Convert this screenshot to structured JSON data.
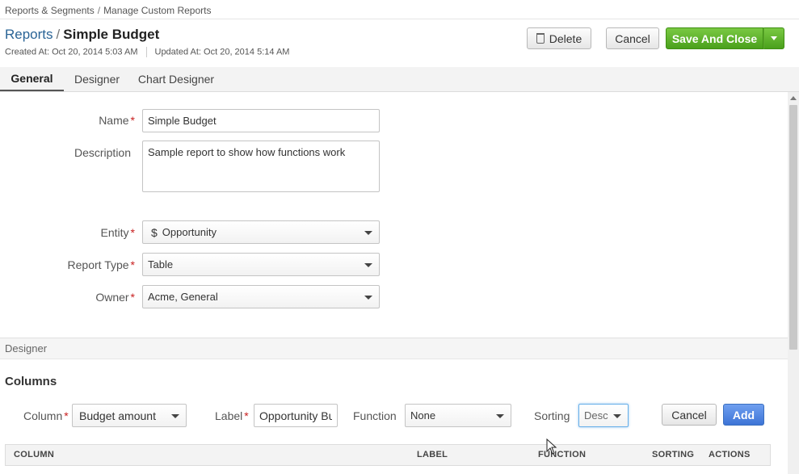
{
  "breadcrumb": {
    "parent": "Reports & Segments",
    "separator": "/",
    "current": "Manage Custom Reports"
  },
  "header": {
    "parent_link": "Reports",
    "separator": "/",
    "title": "Simple Budget",
    "created": "Created At: Oct 20, 2014 5:03 AM",
    "updated": "Updated At: Oct 20, 2014 5:14 AM"
  },
  "toolbar": {
    "delete_label": "Delete",
    "cancel_label": "Cancel",
    "save_label": "Save And Close"
  },
  "tabs": [
    {
      "label": "General",
      "active": true
    },
    {
      "label": "Designer",
      "active": false
    },
    {
      "label": "Chart Designer",
      "active": false
    }
  ],
  "form": {
    "name_label": "Name",
    "name_value": "Simple Budget",
    "description_label": "Description",
    "description_value": "Sample report to show how functions work",
    "entity_label": "Entity",
    "entity_value": "Opportunity",
    "entity_icon": "dollar-icon",
    "report_type_label": "Report Type",
    "report_type_value": "Table",
    "owner_label": "Owner",
    "owner_value": "Acme, General",
    "required_mark": "*"
  },
  "designer": {
    "section_label": "Designer",
    "columns_heading": "Columns",
    "column_label": "Column",
    "column_value": "Budget amount",
    "label_label": "Label",
    "label_value": "Opportunity Budget amount",
    "function_label": "Function",
    "function_value": "None",
    "sorting_label": "Sorting",
    "sorting_value": "Desc",
    "cancel_label": "Cancel",
    "add_label": "Add",
    "table_headers": [
      "COLUMN",
      "LABEL",
      "FUNCTION",
      "SORTING",
      "ACTIONS"
    ]
  },
  "colors": {
    "link": "#2a6496",
    "save_green": "#5cb12b",
    "add_blue": "#4a7fdc",
    "required_red": "#c81e1e"
  }
}
